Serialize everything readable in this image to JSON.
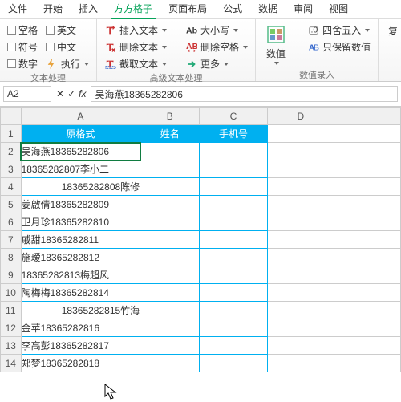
{
  "tabs": {
    "items": [
      "文件",
      "开始",
      "插入",
      "方方格子",
      "页面布局",
      "公式",
      "数据",
      "审阅",
      "视图"
    ],
    "active": 3
  },
  "ribbon": {
    "g1": {
      "title": "文本处理",
      "items": [
        "空格",
        "英文",
        "符号",
        "中文",
        "数字",
        "执行"
      ]
    },
    "g2": {
      "title": "高级文本处理",
      "items": [
        "插入文本",
        "删除文本",
        "截取文本",
        "大小写",
        "删除空格",
        "更多"
      ]
    },
    "g3": {
      "title": "数值录入",
      "big": "数值",
      "items": [
        "四舍五入",
        "只保留数值"
      ]
    }
  },
  "formula": {
    "name": "A2",
    "fx": "fx",
    "value": "吴海燕18365282806"
  },
  "cols": [
    "A",
    "B",
    "C",
    "D"
  ],
  "headers": [
    "原格式",
    "姓名",
    "手机号"
  ],
  "rows": [
    "吴海燕18365282806",
    "18365282807李小二",
    "18365282808陈修",
    "姜啟倩18365282809",
    "卫月珍18365282810",
    "戚甜18365282811",
    "施瑷18365282812",
    "18365282813梅超风",
    "陶梅梅18365282814",
    "18365282815竹海",
    "金苹18365282816",
    "李高彭18365282817",
    "郑梦18365282818"
  ],
  "more": "复"
}
